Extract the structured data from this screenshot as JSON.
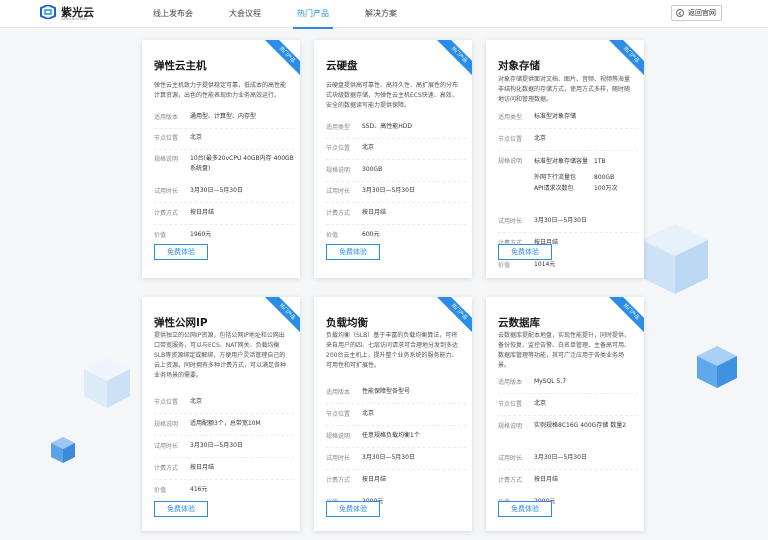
{
  "header": {
    "logo_text": "紫光云",
    "logo_sub": "UNISCLOUD.COM",
    "nav": [
      "线上发布会",
      "大会议程",
      "热门产品",
      "解决方案"
    ],
    "active_index": 2,
    "back_label": "返回官网"
  },
  "ribbon_text": "热门产品",
  "button_label": "免费体验",
  "colors": {
    "accent": "#2a8de6",
    "cube": "#8fc3f0"
  },
  "cards": [
    {
      "title": "弹性云主机",
      "desc": "弹性云主机致力于提供稳定可靠，低成本的高性能计算资源，出色的性能表现助力业务高效运行。",
      "rows": [
        {
          "k": "适用版本",
          "v": "通用型、计算型、内存型"
        },
        {
          "k": "节点位置",
          "v": "北京"
        },
        {
          "k": "规格说明",
          "v": "10台(最多20vCPU 40GB内存 400GB系统盘)"
        },
        {
          "k": "试用时长",
          "v": "3月30日—5月30日"
        },
        {
          "k": "计费方式",
          "v": "按日月结"
        },
        {
          "k": "价值",
          "v": "1960元"
        }
      ]
    },
    {
      "title": "云硬盘",
      "desc": "云硬盘提供高可靠性、高持久性、高扩展性的分布式块级数据存储，为弹性云主机ECS快速、高效、安全的数据读写能力提供保障。",
      "rows": [
        {
          "k": "适用类型",
          "v": "SSD、高性能HDD"
        },
        {
          "k": "节点位置",
          "v": "北京"
        },
        {
          "k": "规格说明",
          "v": "300GB"
        },
        {
          "k": "试用时长",
          "v": "3月30日—5月30日"
        },
        {
          "k": "计费方式",
          "v": "按日月结"
        },
        {
          "k": "价值",
          "v": "600元"
        }
      ]
    },
    {
      "title": "对象存储",
      "desc": "对象存储提供面对文档、图片、音频、视频等海量非结构化数据的存储方式，使用方式多样，随时随地访问和管理数据。",
      "rows": [
        {
          "k": "适用类型",
          "v": "标准型对象存储"
        },
        {
          "k": "节点位置",
          "v": "北京"
        },
        {
          "k": "规格说明",
          "v": "",
          "sub": [
            {
              "sk": "标准型对象存储容量",
              "sv": "1TB"
            },
            {
              "sk": "外网下行流量包",
              "sv": "800GB"
            },
            {
              "sk": "API请求次数包",
              "sv": "100万次"
            }
          ]
        },
        {
          "k": "试用时长",
          "v": "3月30日—5月30日"
        },
        {
          "k": "计费方式",
          "v": "按日月结"
        },
        {
          "k": "价值",
          "v": "1014元"
        }
      ]
    },
    {
      "title": "弹性公网IP",
      "desc": "提供独立的公网IP资源，包括公网IP地址和公网出口带宽服务，可以与ECS、NAT网关、负载均衡SLB等资源绑定或解绑，方便用户灵活管理自己的云上资源。同时拥有多种计费方式，可以满足各种业务场景的需要。",
      "rows": [
        {
          "k": "节点位置",
          "v": "北京"
        },
        {
          "k": "规格说明",
          "v": "适用配额3个，总带宽10M"
        },
        {
          "k": "试用时长",
          "v": "3月30日—5月30日"
        },
        {
          "k": "计费方式",
          "v": "按日月结"
        },
        {
          "k": "价值",
          "v": "416元"
        }
      ]
    },
    {
      "title": "负载均衡",
      "desc": "负载均衡（SLB）基于丰富的负载均衡算法，可将来自用户的四、七层访问请求可合理地分发到多达200台云主机上，提升整个业务系统的服务能力、可用性和可扩展性。",
      "rows": [
        {
          "k": "适用版本",
          "v": "性能保障型各型号"
        },
        {
          "k": "节点位置",
          "v": "北京"
        },
        {
          "k": "规格说明",
          "v": "任意规格负载均衡1个"
        },
        {
          "k": "试用时长",
          "v": "3月30日—5月30日"
        },
        {
          "k": "计费方式",
          "v": "按日月结"
        },
        {
          "k": "价值",
          "v": "2000元"
        }
      ]
    },
    {
      "title": "云数据库",
      "desc": "云数据库提配本地盘，实现性能提升，同时提供、备份恢复、监控告警、白名单管理、主备高可用、数据库管理等功能，其可广泛应用于各类业务场景。",
      "rows": [
        {
          "k": "适用版本",
          "v": "MySQL 5.7"
        },
        {
          "k": "节点位置",
          "v": "北京"
        },
        {
          "k": "规格说明",
          "v": "实例规格8C16G 400G存储 数量2"
        },
        {
          "k": "试用时长",
          "v": "3月30日—5月30日"
        },
        {
          "k": "计费方式",
          "v": "按日月结"
        },
        {
          "k": "价值",
          "v": "2000元"
        }
      ]
    }
  ]
}
